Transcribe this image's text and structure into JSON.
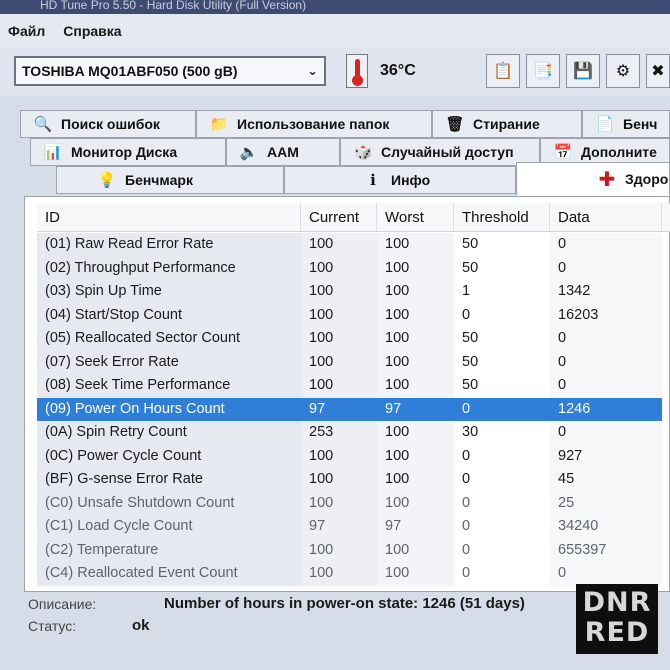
{
  "window": {
    "title": "HD Tune Pro 5.50 - Hard Disk Utility (Full Version)"
  },
  "menu": {
    "file": "Файл",
    "help": "Справка"
  },
  "toolbar": {
    "drive": "TOSHIBA MQ01ABF050 (500 gB)",
    "temperature": "36°C",
    "icons": [
      "copy-icon",
      "copy-all-icon",
      "save-icon",
      "options-icon",
      "exit-icon"
    ]
  },
  "tabs": {
    "row1": [
      "Поиск ошибок",
      "Использование папок",
      "Стирание",
      "Бенч"
    ],
    "row2": [
      "Монитор Диска",
      "AAM",
      "Случайный доступ",
      "Дополните"
    ],
    "row3": [
      "Бенчмарк",
      "Инфо",
      "Здоро"
    ]
  },
  "table": {
    "headers": [
      "ID",
      "Current",
      "Worst",
      "Threshold",
      "Data"
    ],
    "rows": [
      [
        "(01) Raw Read Error Rate",
        "100",
        "100",
        "50",
        "0"
      ],
      [
        "(02) Throughput Performance",
        "100",
        "100",
        "50",
        "0"
      ],
      [
        "(03) Spin Up Time",
        "100",
        "100",
        "1",
        "1342"
      ],
      [
        "(04) Start/Stop Count",
        "100",
        "100",
        "0",
        "16203"
      ],
      [
        "(05) Reallocated Sector Count",
        "100",
        "100",
        "50",
        "0"
      ],
      [
        "(07) Seek Error Rate",
        "100",
        "100",
        "50",
        "0"
      ],
      [
        "(08) Seek Time Performance",
        "100",
        "100",
        "50",
        "0"
      ],
      [
        "(09) Power On Hours Count",
        "97",
        "97",
        "0",
        "1246"
      ],
      [
        "(0A) Spin Retry Count",
        "253",
        "100",
        "30",
        "0"
      ],
      [
        "(0C) Power Cycle Count",
        "100",
        "100",
        "0",
        "927"
      ],
      [
        "(BF) G-sense Error Rate",
        "100",
        "100",
        "0",
        "45"
      ],
      [
        "(C0) Unsafe Shutdown Count",
        "100",
        "100",
        "0",
        "25"
      ],
      [
        "(C1) Load Cycle Count",
        "97",
        "97",
        "0",
        "34240"
      ],
      [
        "(C2) Temperature",
        "100",
        "100",
        "0",
        "655397"
      ],
      [
        "(C4) Reallocated Event Count",
        "100",
        "100",
        "0",
        "0"
      ]
    ]
  },
  "status": {
    "description_label": "Описание:",
    "description": "Number of hours in power-on state: 1246 (51 days)",
    "status_label": "Статус:",
    "status_value": "ok"
  },
  "watermark": {
    "line1": "DNR",
    "line2": "RED"
  },
  "colors": {
    "selection": "#2f7fd8",
    "background": "#d7dde8"
  }
}
